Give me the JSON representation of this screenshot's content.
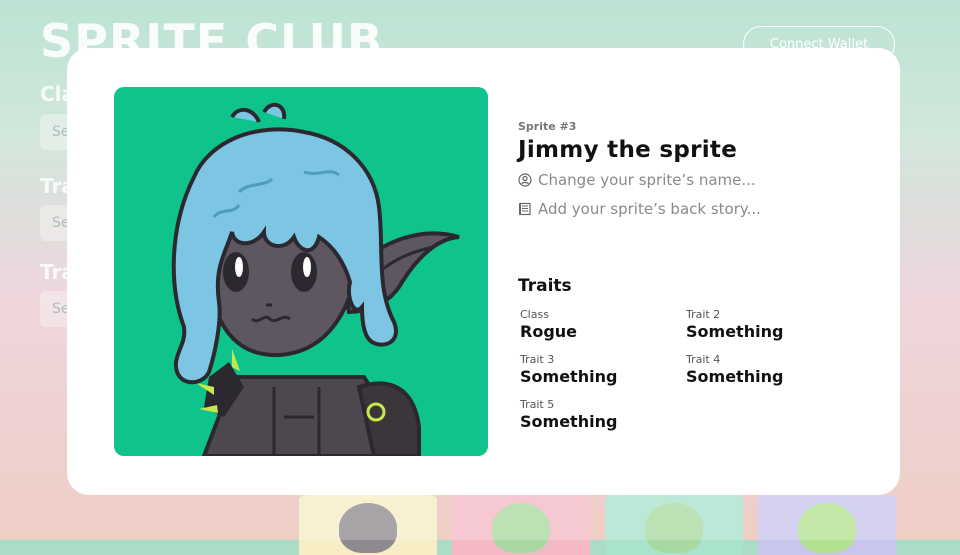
{
  "header": {
    "logo": "SPRITE CLUB",
    "connect_wallet": "Connect Wallet"
  },
  "filters": [
    {
      "label": "Class",
      "placeholder": "Se"
    },
    {
      "label": "Trait",
      "placeholder": "Se"
    },
    {
      "label": "Trait",
      "placeholder": "Se"
    }
  ],
  "modal": {
    "sprite_number": "Sprite #3",
    "sprite_name": "Jimmy the sprite",
    "change_name_link": "Change your sprite’s name...",
    "back_story_link": "Add your sprite’s back story...",
    "traits_heading": "Traits",
    "traits": [
      {
        "label": "Class",
        "value": "Rogue"
      },
      {
        "label": "Trait 2",
        "value": "Something"
      },
      {
        "label": "Trait 3",
        "value": "Something"
      },
      {
        "label": "Trait 4",
        "value": "Something"
      },
      {
        "label": "Trait 5",
        "value": "Something"
      }
    ],
    "art_background": "#0fc48c"
  },
  "colors": {
    "modal_bg": "#ffffff",
    "text_primary": "#111111",
    "text_muted": "#8a8a8a"
  },
  "icons": {
    "change_name": "user-circle-icon",
    "back_story": "notebook-icon"
  }
}
